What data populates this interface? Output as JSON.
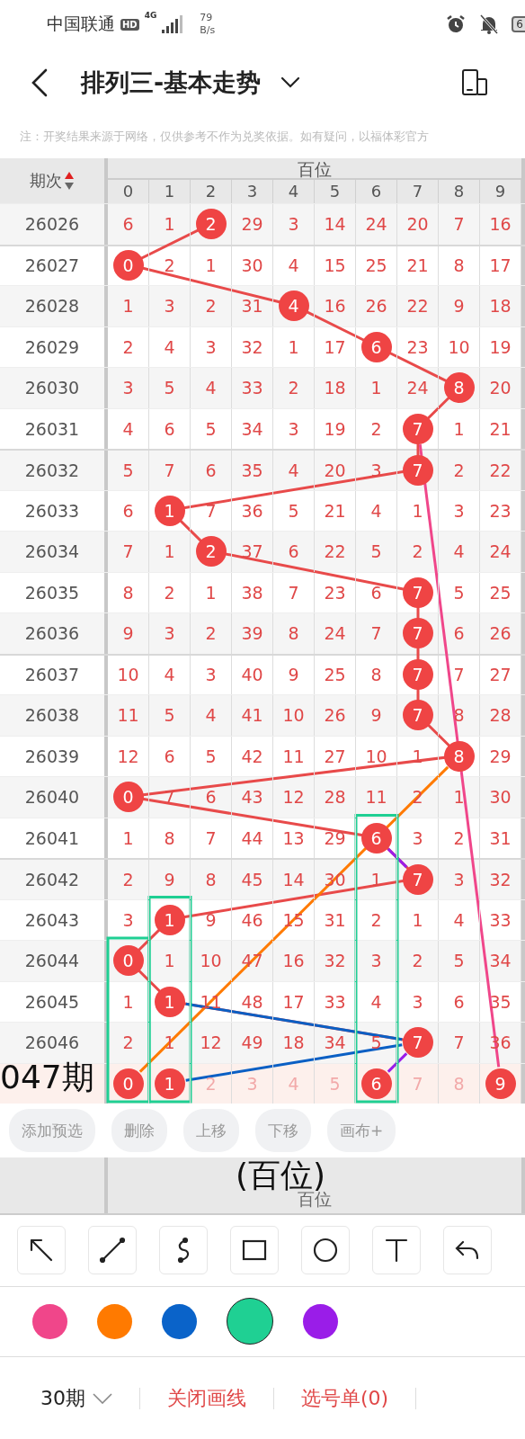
{
  "status_bar": {
    "carrier": "中国联通",
    "hd": "HD",
    "network": "4G",
    "speed_value": "79",
    "speed_unit": "B/s",
    "battery": "6"
  },
  "title_bar": {
    "title": "排列三-基本走势"
  },
  "notice": "注：开奖结果来源于网络，仅供参考不作为兑奖依据。如有疑问，以福体彩官方",
  "table": {
    "period_header": "期次",
    "group_header": "百位",
    "digits": [
      "0",
      "1",
      "2",
      "3",
      "4",
      "5",
      "6",
      "7",
      "8",
      "9"
    ],
    "rows": [
      {
        "issue": "26026",
        "cells": [
          {
            "text": "6",
            "hit": false
          },
          {
            "text": "1",
            "hit": false
          },
          {
            "text": "2",
            "hit": true
          },
          {
            "text": "29",
            "hit": false
          },
          {
            "text": "3",
            "hit": false
          },
          {
            "text": "14",
            "hit": false
          },
          {
            "text": "24",
            "hit": false
          },
          {
            "text": "20",
            "hit": false
          },
          {
            "text": "7",
            "hit": false
          },
          {
            "text": "16",
            "hit": false
          }
        ]
      },
      {
        "issue": "26027",
        "cells": [
          {
            "text": "0",
            "hit": true
          },
          {
            "text": "2",
            "hit": false
          },
          {
            "text": "1",
            "hit": false
          },
          {
            "text": "30",
            "hit": false
          },
          {
            "text": "4",
            "hit": false
          },
          {
            "text": "15",
            "hit": false
          },
          {
            "text": "25",
            "hit": false
          },
          {
            "text": "21",
            "hit": false
          },
          {
            "text": "8",
            "hit": false
          },
          {
            "text": "17",
            "hit": false
          }
        ]
      },
      {
        "issue": "26028",
        "cells": [
          {
            "text": "1",
            "hit": false
          },
          {
            "text": "3",
            "hit": false
          },
          {
            "text": "2",
            "hit": false
          },
          {
            "text": "31",
            "hit": false
          },
          {
            "text": "4",
            "hit": true
          },
          {
            "text": "16",
            "hit": false
          },
          {
            "text": "26",
            "hit": false
          },
          {
            "text": "22",
            "hit": false
          },
          {
            "text": "9",
            "hit": false
          },
          {
            "text": "18",
            "hit": false
          }
        ]
      },
      {
        "issue": "26029",
        "cells": [
          {
            "text": "2",
            "hit": false
          },
          {
            "text": "4",
            "hit": false
          },
          {
            "text": "3",
            "hit": false
          },
          {
            "text": "32",
            "hit": false
          },
          {
            "text": "1",
            "hit": false
          },
          {
            "text": "17",
            "hit": false
          },
          {
            "text": "6",
            "hit": true
          },
          {
            "text": "23",
            "hit": false
          },
          {
            "text": "10",
            "hit": false
          },
          {
            "text": "19",
            "hit": false
          }
        ]
      },
      {
        "issue": "26030",
        "cells": [
          {
            "text": "3",
            "hit": false
          },
          {
            "text": "5",
            "hit": false
          },
          {
            "text": "4",
            "hit": false
          },
          {
            "text": "33",
            "hit": false
          },
          {
            "text": "2",
            "hit": false
          },
          {
            "text": "18",
            "hit": false
          },
          {
            "text": "1",
            "hit": false
          },
          {
            "text": "24",
            "hit": false
          },
          {
            "text": "8",
            "hit": true
          },
          {
            "text": "20",
            "hit": false
          }
        ]
      },
      {
        "issue": "26031",
        "cells": [
          {
            "text": "4",
            "hit": false
          },
          {
            "text": "6",
            "hit": false
          },
          {
            "text": "5",
            "hit": false
          },
          {
            "text": "34",
            "hit": false
          },
          {
            "text": "3",
            "hit": false
          },
          {
            "text": "19",
            "hit": false
          },
          {
            "text": "2",
            "hit": false
          },
          {
            "text": "7",
            "hit": true
          },
          {
            "text": "1",
            "hit": false
          },
          {
            "text": "21",
            "hit": false
          }
        ]
      },
      {
        "issue": "26032",
        "cells": [
          {
            "text": "5",
            "hit": false
          },
          {
            "text": "7",
            "hit": false
          },
          {
            "text": "6",
            "hit": false
          },
          {
            "text": "35",
            "hit": false
          },
          {
            "text": "4",
            "hit": false
          },
          {
            "text": "20",
            "hit": false
          },
          {
            "text": "3",
            "hit": false
          },
          {
            "text": "7",
            "hit": true
          },
          {
            "text": "2",
            "hit": false
          },
          {
            "text": "22",
            "hit": false
          }
        ]
      },
      {
        "issue": "26033",
        "cells": [
          {
            "text": "6",
            "hit": false
          },
          {
            "text": "1",
            "hit": true
          },
          {
            "text": "7",
            "hit": false
          },
          {
            "text": "36",
            "hit": false
          },
          {
            "text": "5",
            "hit": false
          },
          {
            "text": "21",
            "hit": false
          },
          {
            "text": "4",
            "hit": false
          },
          {
            "text": "1",
            "hit": false
          },
          {
            "text": "3",
            "hit": false
          },
          {
            "text": "23",
            "hit": false
          }
        ]
      },
      {
        "issue": "26034",
        "cells": [
          {
            "text": "7",
            "hit": false
          },
          {
            "text": "1",
            "hit": false
          },
          {
            "text": "2",
            "hit": true
          },
          {
            "text": "37",
            "hit": false
          },
          {
            "text": "6",
            "hit": false
          },
          {
            "text": "22",
            "hit": false
          },
          {
            "text": "5",
            "hit": false
          },
          {
            "text": "2",
            "hit": false
          },
          {
            "text": "4",
            "hit": false
          },
          {
            "text": "24",
            "hit": false
          }
        ]
      },
      {
        "issue": "26035",
        "cells": [
          {
            "text": "8",
            "hit": false
          },
          {
            "text": "2",
            "hit": false
          },
          {
            "text": "1",
            "hit": false
          },
          {
            "text": "38",
            "hit": false
          },
          {
            "text": "7",
            "hit": false
          },
          {
            "text": "23",
            "hit": false
          },
          {
            "text": "6",
            "hit": false
          },
          {
            "text": "7",
            "hit": true
          },
          {
            "text": "5",
            "hit": false
          },
          {
            "text": "25",
            "hit": false
          }
        ]
      },
      {
        "issue": "26036",
        "cells": [
          {
            "text": "9",
            "hit": false
          },
          {
            "text": "3",
            "hit": false
          },
          {
            "text": "2",
            "hit": false
          },
          {
            "text": "39",
            "hit": false
          },
          {
            "text": "8",
            "hit": false
          },
          {
            "text": "24",
            "hit": false
          },
          {
            "text": "7",
            "hit": false
          },
          {
            "text": "7",
            "hit": true
          },
          {
            "text": "6",
            "hit": false
          },
          {
            "text": "26",
            "hit": false
          }
        ]
      },
      {
        "issue": "26037",
        "cells": [
          {
            "text": "10",
            "hit": false
          },
          {
            "text": "4",
            "hit": false
          },
          {
            "text": "3",
            "hit": false
          },
          {
            "text": "40",
            "hit": false
          },
          {
            "text": "9",
            "hit": false
          },
          {
            "text": "25",
            "hit": false
          },
          {
            "text": "8",
            "hit": false
          },
          {
            "text": "7",
            "hit": true
          },
          {
            "text": "7",
            "hit": false
          },
          {
            "text": "27",
            "hit": false
          }
        ]
      },
      {
        "issue": "26038",
        "cells": [
          {
            "text": "11",
            "hit": false
          },
          {
            "text": "5",
            "hit": false
          },
          {
            "text": "4",
            "hit": false
          },
          {
            "text": "41",
            "hit": false
          },
          {
            "text": "10",
            "hit": false
          },
          {
            "text": "26",
            "hit": false
          },
          {
            "text": "9",
            "hit": false
          },
          {
            "text": "7",
            "hit": true
          },
          {
            "text": "8",
            "hit": false
          },
          {
            "text": "28",
            "hit": false
          }
        ]
      },
      {
        "issue": "26039",
        "cells": [
          {
            "text": "12",
            "hit": false
          },
          {
            "text": "6",
            "hit": false
          },
          {
            "text": "5",
            "hit": false
          },
          {
            "text": "42",
            "hit": false
          },
          {
            "text": "11",
            "hit": false
          },
          {
            "text": "27",
            "hit": false
          },
          {
            "text": "10",
            "hit": false
          },
          {
            "text": "1",
            "hit": false
          },
          {
            "text": "8",
            "hit": true
          },
          {
            "text": "29",
            "hit": false
          }
        ]
      },
      {
        "issue": "26040",
        "cells": [
          {
            "text": "0",
            "hit": true
          },
          {
            "text": "7",
            "hit": false
          },
          {
            "text": "6",
            "hit": false
          },
          {
            "text": "43",
            "hit": false
          },
          {
            "text": "12",
            "hit": false
          },
          {
            "text": "28",
            "hit": false
          },
          {
            "text": "11",
            "hit": false
          },
          {
            "text": "2",
            "hit": false
          },
          {
            "text": "1",
            "hit": false
          },
          {
            "text": "30",
            "hit": false
          }
        ]
      },
      {
        "issue": "26041",
        "cells": [
          {
            "text": "1",
            "hit": false
          },
          {
            "text": "8",
            "hit": false
          },
          {
            "text": "7",
            "hit": false
          },
          {
            "text": "44",
            "hit": false
          },
          {
            "text": "13",
            "hit": false
          },
          {
            "text": "29",
            "hit": false
          },
          {
            "text": "6",
            "hit": true
          },
          {
            "text": "3",
            "hit": false
          },
          {
            "text": "2",
            "hit": false
          },
          {
            "text": "31",
            "hit": false
          }
        ]
      },
      {
        "issue": "26042",
        "cells": [
          {
            "text": "2",
            "hit": false
          },
          {
            "text": "9",
            "hit": false
          },
          {
            "text": "8",
            "hit": false
          },
          {
            "text": "45",
            "hit": false
          },
          {
            "text": "14",
            "hit": false
          },
          {
            "text": "30",
            "hit": false
          },
          {
            "text": "1",
            "hit": false
          },
          {
            "text": "7",
            "hit": true
          },
          {
            "text": "3",
            "hit": false
          },
          {
            "text": "32",
            "hit": false
          }
        ]
      },
      {
        "issue": "26043",
        "cells": [
          {
            "text": "3",
            "hit": false
          },
          {
            "text": "1",
            "hit": true
          },
          {
            "text": "9",
            "hit": false
          },
          {
            "text": "46",
            "hit": false
          },
          {
            "text": "15",
            "hit": false
          },
          {
            "text": "31",
            "hit": false
          },
          {
            "text": "2",
            "hit": false
          },
          {
            "text": "1",
            "hit": false
          },
          {
            "text": "4",
            "hit": false
          },
          {
            "text": "33",
            "hit": false
          }
        ]
      },
      {
        "issue": "26044",
        "cells": [
          {
            "text": "0",
            "hit": true
          },
          {
            "text": "1",
            "hit": false
          },
          {
            "text": "10",
            "hit": false
          },
          {
            "text": "47",
            "hit": false
          },
          {
            "text": "16",
            "hit": false
          },
          {
            "text": "32",
            "hit": false
          },
          {
            "text": "3",
            "hit": false
          },
          {
            "text": "2",
            "hit": false
          },
          {
            "text": "5",
            "hit": false
          },
          {
            "text": "34",
            "hit": false
          }
        ]
      },
      {
        "issue": "26045",
        "cells": [
          {
            "text": "1",
            "hit": false
          },
          {
            "text": "1",
            "hit": true
          },
          {
            "text": "11",
            "hit": false
          },
          {
            "text": "48",
            "hit": false
          },
          {
            "text": "17",
            "hit": false
          },
          {
            "text": "33",
            "hit": false
          },
          {
            "text": "4",
            "hit": false
          },
          {
            "text": "3",
            "hit": false
          },
          {
            "text": "6",
            "hit": false
          },
          {
            "text": "35",
            "hit": false
          }
        ]
      },
      {
        "issue": "26046",
        "cells": [
          {
            "text": "2",
            "hit": false
          },
          {
            "text": "1",
            "hit": false
          },
          {
            "text": "12",
            "hit": false
          },
          {
            "text": "49",
            "hit": false
          },
          {
            "text": "18",
            "hit": false
          },
          {
            "text": "34",
            "hit": false
          },
          {
            "text": "5",
            "hit": false
          },
          {
            "text": "7",
            "hit": true
          },
          {
            "text": "7",
            "hit": false
          },
          {
            "text": "36",
            "hit": false
          }
        ]
      }
    ],
    "preview_row": {
      "label": "047期",
      "cells": [
        {
          "text": "0",
          "hit": true
        },
        {
          "text": "1",
          "hit": true
        },
        {
          "text": "2",
          "hit": false
        },
        {
          "text": "3",
          "hit": false
        },
        {
          "text": "4",
          "hit": false
        },
        {
          "text": "5",
          "hit": false
        },
        {
          "text": "6",
          "hit": true
        },
        {
          "text": "7",
          "hit": false
        },
        {
          "text": "8",
          "hit": false
        },
        {
          "text": "9",
          "hit": true
        }
      ]
    },
    "annotations": [
      {
        "kind": "line",
        "color": "#f0468a"
      },
      {
        "kind": "line",
        "color": "#ff7a00"
      },
      {
        "kind": "line",
        "color": "#0a5fc4"
      },
      {
        "kind": "line",
        "color": "#0a5fc4"
      },
      {
        "kind": "line",
        "color": "#9a1de8"
      },
      {
        "kind": "line",
        "color": "#9a1de8"
      },
      {
        "kind": "rect",
        "color": "#1fcf93"
      },
      {
        "kind": "rect",
        "color": "#1fcf93"
      },
      {
        "kind": "rect",
        "color": "#1fcf93"
      }
    ]
  },
  "actions": [
    "添加预选",
    "删除",
    "上移",
    "下移",
    "画布+"
  ],
  "drag_hint": "(百位)",
  "sticky_header": "百位",
  "tools": [
    {
      "kind": "arrow",
      "selected": false
    },
    {
      "kind": "line",
      "selected": false
    },
    {
      "kind": "curve",
      "selected": false
    },
    {
      "kind": "rect",
      "selected": false
    },
    {
      "kind": "circle",
      "selected": false
    },
    {
      "kind": "text",
      "selected": false
    },
    {
      "kind": "undo",
      "selected": false
    }
  ],
  "colors": [
    {
      "color": "#f0468a",
      "selected": false
    },
    {
      "color": "#ff7a00",
      "selected": false
    },
    {
      "color": "#0a63c9",
      "selected": false
    },
    {
      "color": "#1fd093",
      "selected": true
    },
    {
      "color": "#9a1de8",
      "selected": false
    }
  ],
  "bottom_bar": {
    "period": "30期",
    "close_draw": "关闭画线",
    "pick_list": "选号单(0)"
  }
}
